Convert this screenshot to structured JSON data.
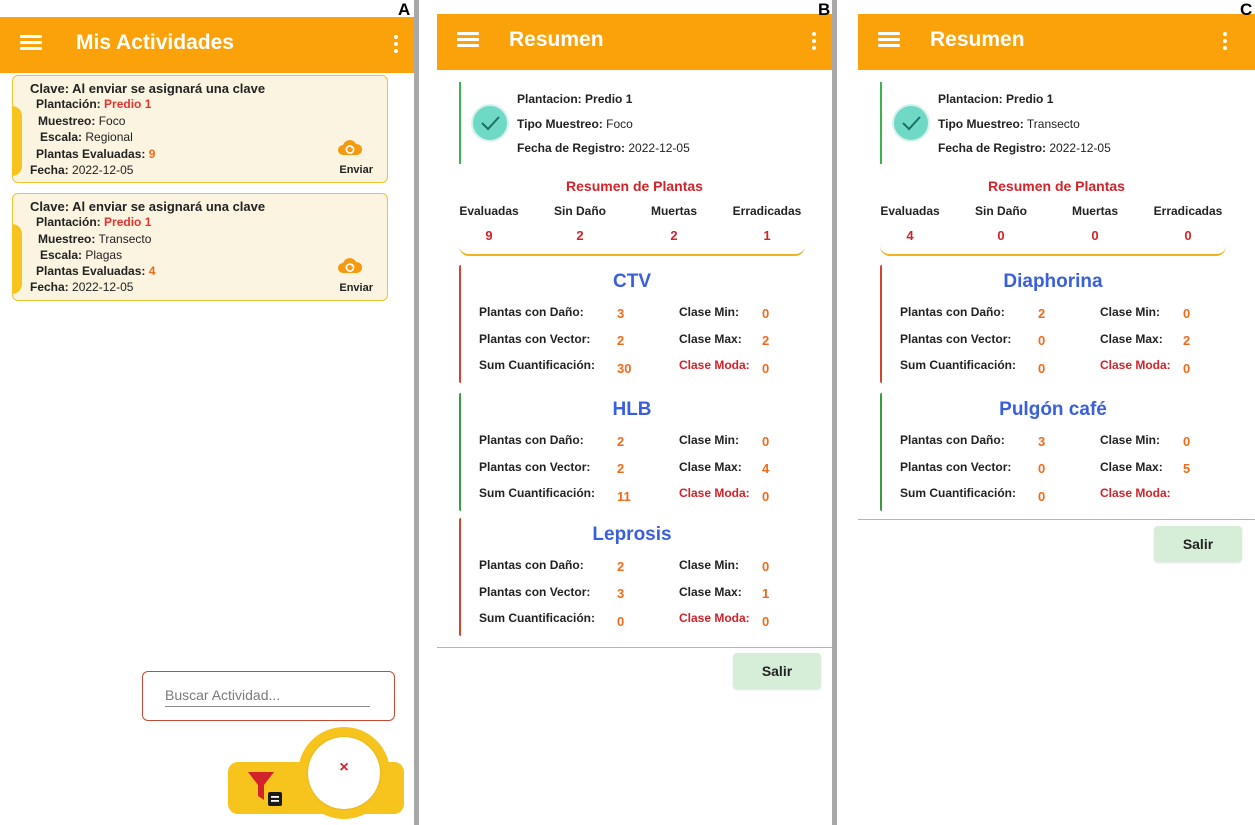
{
  "colors": {
    "appbar": "#fba20a",
    "card_bg": "#fbf4e0",
    "card_border": "#f2c232",
    "title_red": "#d2232a",
    "value_orange": "#f06a1c",
    "disease_blue": "#3a5fdc",
    "salir_bg": "#d6eed8"
  },
  "panel_a": {
    "letter": "A",
    "title": "Mis Actividades",
    "cards": [
      {
        "clave_label": "Clave:",
        "clave": "Al enviar se asignará una clave",
        "plantacion_label": "Plantación:",
        "plantacion": "Predio 1",
        "muestreo_label": "Muestreo:",
        "muestreo": "Foco",
        "escala_label": "Escala:",
        "escala": "Regional",
        "plantas_label": "Plantas Evaluadas:",
        "plantas": "9",
        "fecha_label": "Fecha:",
        "fecha": "2022-12-05",
        "send_label": "Enviar",
        "send_icon": "cloud-sync-icon"
      },
      {
        "clave_label": "Clave:",
        "clave": "Al enviar se asignará una clave",
        "plantacion_label": "Plantación:",
        "plantacion": "Predio 1",
        "muestreo_label": "Muestreo:",
        "muestreo": "Transecto",
        "escala_label": "Escala:",
        "escala": "Plagas",
        "plantas_label": "Plantas Evaluadas:",
        "plantas": "4",
        "fecha_label": "Fecha:",
        "fecha": "2022-12-05",
        "send_label": "Enviar",
        "send_icon": "cloud-sync-icon"
      }
    ],
    "search_placeholder": "Buscar Actividad...",
    "fab_close": "×",
    "filter_icon": "filter-list-icon"
  },
  "panel_b": {
    "letter": "B",
    "title": "Resumen",
    "plantacion_label": "Plantacion:",
    "plantacion": "Predio 1",
    "tipo_label": "Tipo Muestreo:",
    "tipo": "Foco",
    "fecha_label": "Fecha de Registro:",
    "fecha": "2022-12-05",
    "resumen_title": "Resumen de Plantas",
    "headers": [
      "Evaluadas",
      "Sin Daño",
      "Muertas",
      "Erradicadas"
    ],
    "values": [
      "9",
      "2",
      "2",
      "1"
    ],
    "sections": [
      {
        "name": "CTV",
        "danio": "3",
        "vector": "2",
        "sum": "30",
        "min": "0",
        "max": "2",
        "moda": "0"
      },
      {
        "name": "HLB",
        "danio": "2",
        "vector": "2",
        "sum": "11",
        "min": "0",
        "max": "4",
        "moda": "0"
      },
      {
        "name": "Leprosis",
        "danio": "2",
        "vector": "3",
        "sum": "0",
        "min": "0",
        "max": "1",
        "moda": "0"
      }
    ],
    "salir": "Salir"
  },
  "panel_c": {
    "letter": "C",
    "title": "Resumen",
    "plantacion_label": "Plantacion:",
    "plantacion": "Predio 1",
    "tipo_label": "Tipo Muestreo:",
    "tipo": "Transecto",
    "fecha_label": "Fecha de Registro:",
    "fecha": "2022-12-05",
    "resumen_title": "Resumen de Plantas",
    "headers": [
      "Evaluadas",
      "Sin Daño",
      "Muertas",
      "Erradicadas"
    ],
    "values": [
      "4",
      "0",
      "0",
      "0"
    ],
    "sections": [
      {
        "name": "Diaphorina",
        "danio": "2",
        "vector": "0",
        "sum": "0",
        "min": "0",
        "max": "2",
        "moda": "0"
      },
      {
        "name": "Pulgón café",
        "danio": "3",
        "vector": "0",
        "sum": "0",
        "min": "0",
        "max": "5",
        "moda": ""
      }
    ],
    "salir": "Salir"
  },
  "section_labels": {
    "danio": "Plantas con Daño:",
    "vector": "Plantas con Vector:",
    "sum": "Sum Cuantificación:",
    "min": "Clase Min:",
    "max": "Clase Max:",
    "moda": "Clase Moda:"
  }
}
